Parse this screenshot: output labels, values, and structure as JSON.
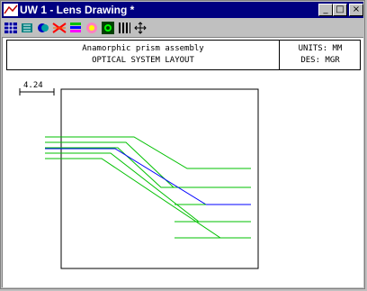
{
  "window": {
    "title": "UW 1 - Lens Drawing *",
    "buttons": {
      "minimize": "_",
      "maximize": "□",
      "close": "×"
    }
  },
  "toolbar": {
    "icons": [
      "grid-icon",
      "settings-icon",
      "layers-icon",
      "ray-fan-icon",
      "color-spectrum-icon",
      "aperture-icon",
      "target-icon",
      "bars-icon",
      "pan-arrows-icon"
    ]
  },
  "header": {
    "line1": "Anamorphic prism assembly",
    "line2": "OPTICAL SYSTEM LAYOUT",
    "units": "UNITS: MM",
    "designer": "DES: MGR"
  },
  "scale_bar": {
    "label": "4.24"
  },
  "colors": {
    "titlebar": "#000080",
    "ray_green": "#00c000",
    "ray_blue": "#0000ff"
  }
}
